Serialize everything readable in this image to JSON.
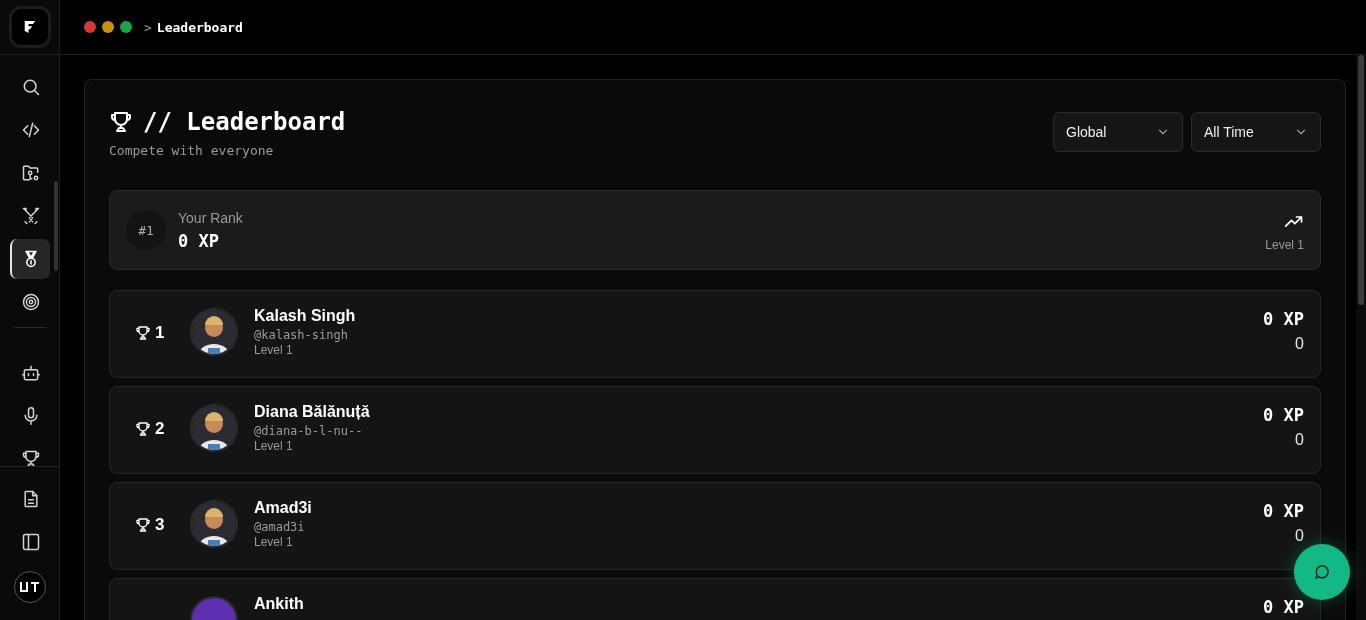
{
  "topbar": {
    "separator": ">",
    "current": "Leaderboard"
  },
  "sidebar": {
    "items": [
      {
        "kind": "search",
        "selected": false
      },
      {
        "kind": "code",
        "selected": false
      },
      {
        "kind": "folder-key",
        "selected": false
      },
      {
        "kind": "swords",
        "selected": false
      },
      {
        "kind": "medal",
        "selected": true
      },
      {
        "kind": "target",
        "selected": false
      },
      {
        "kind": "divider"
      },
      {
        "kind": "bot",
        "selected": false
      },
      {
        "kind": "mic",
        "selected": false
      },
      {
        "kind": "trophy",
        "selected": false
      }
    ],
    "bottom_items": [
      {
        "kind": "file"
      },
      {
        "kind": "panel"
      },
      {
        "kind": "avatar"
      }
    ]
  },
  "header": {
    "title": "// Leaderboard",
    "subtitle": "Compete with everyone"
  },
  "filters": [
    {
      "value": "Global"
    },
    {
      "value": "All Time"
    }
  ],
  "your_rank": {
    "rank": "#1",
    "label": "Your Rank",
    "xp": "0 XP",
    "level": "Level 1"
  },
  "entries": [
    {
      "rank": "1",
      "name": "Kalash Singh",
      "handle": "@kalash-singh",
      "level": "Level 1",
      "xp": "0 XP",
      "score": "0"
    },
    {
      "rank": "2",
      "name": "Diana Bălănuță",
      "handle": "@diana-b-l-nu--",
      "level": "Level 1",
      "xp": "0 XP",
      "score": "0"
    },
    {
      "rank": "3",
      "name": "Amad3i",
      "handle": "@amad3i",
      "level": "Level 1",
      "xp": "0 XP",
      "score": "0"
    },
    {
      "name": "Ankith",
      "xp": "0 XP",
      "avatar": {
        "kind": "plain",
        "color": "#5b2fb0"
      }
    }
  ]
}
